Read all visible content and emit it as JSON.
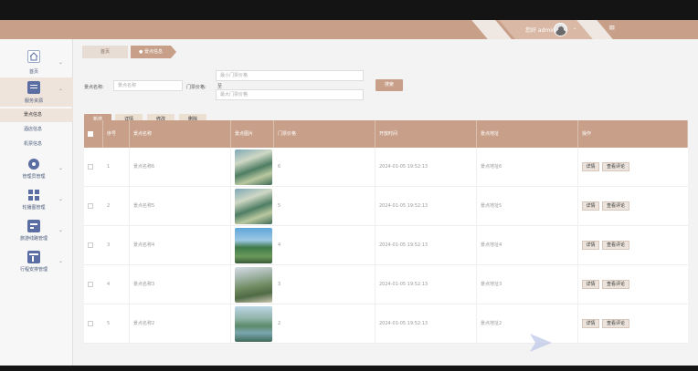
{
  "header": {
    "user_text": "您好 admin",
    "caret": "⌄",
    "menu_icon": "≡"
  },
  "sidebar": {
    "items": [
      {
        "label": "首页",
        "icon": "home-icon",
        "color": "#cfd8e8"
      },
      {
        "label": "服务资源",
        "icon": "list-icon",
        "color": "#5b6ea3",
        "active": true
      },
      {
        "label": "管理员管理",
        "icon": "circle-icon",
        "color": "#5b6ea3"
      },
      {
        "label": "轮播图管理",
        "icon": "grid-icon",
        "color": "#5b6ea3"
      },
      {
        "label": "旅游线路管理",
        "icon": "dashboard-icon",
        "color": "#5b6ea3"
      },
      {
        "label": "行程安排管理",
        "icon": "calendar-icon",
        "color": "#5b6ea3"
      }
    ],
    "sub_items": [
      "景点信息",
      "酒店信息",
      "机票信息"
    ]
  },
  "breadcrumb": {
    "home": "首页",
    "current": "● 景点信息"
  },
  "search": {
    "name_label": "景点名称:",
    "name_placeholder": "景点名称",
    "price_label": "门票价格:",
    "price_min_placeholder": "最小门票价格",
    "price_sep": "至",
    "price_max_placeholder": "最大门票价格",
    "search_button": "搜索"
  },
  "toolbar": {
    "add": "新增",
    "detail": "详情",
    "edit": "修改",
    "delete": "删除"
  },
  "table": {
    "headers": [
      "",
      "序号",
      "景点名称",
      "景点图片",
      "门票价格",
      "开放时间",
      "景点地址",
      "操作"
    ],
    "rows": [
      {
        "index": "1",
        "name": "景点名称6",
        "price": "6",
        "time": "2024-01-05 19:52:13",
        "address": "景点地址6"
      },
      {
        "index": "2",
        "name": "景点名称5",
        "price": "5",
        "time": "2024-01-05 19:52:13",
        "address": "景点地址5"
      },
      {
        "index": "3",
        "name": "景点名称4",
        "price": "4",
        "time": "2024-01-05 19:52:13",
        "address": "景点地址4"
      },
      {
        "index": "4",
        "name": "景点名称3",
        "price": "3",
        "time": "2024-01-05 19:52:13",
        "address": "景点地址3"
      },
      {
        "index": "5",
        "name": "景点名称2",
        "price": "2",
        "time": "2024-01-05 19:52:13",
        "address": "景点地址2"
      }
    ],
    "op_detail": "详情",
    "op_review": "查看评论"
  },
  "colors": {
    "brand": "#c8a08a",
    "header_stripe": "#efe8e2",
    "sidebar_icon": "#5b6ea3"
  }
}
